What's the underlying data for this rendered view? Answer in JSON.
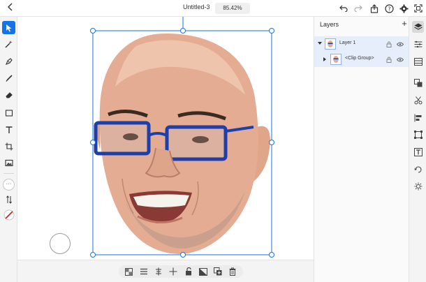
{
  "app": {
    "document_title": "Untitled-3",
    "zoom_level": "85.42%",
    "back_icon": "chevron-left-icon"
  },
  "topbar_icons": [
    "undo-icon",
    "redo-icon",
    "share-icon",
    "help-icon",
    "settings-icon",
    "fullscreen-icon"
  ],
  "left_tools": [
    "select-icon",
    "magic-select-icon",
    "pen-icon",
    "brush-icon",
    "eraser-icon",
    "rectangle-icon",
    "text-icon",
    "crop-icon",
    "image-icon",
    "more-icon",
    "swap-colors-icon",
    "color-swatch-icon"
  ],
  "more_label": "···",
  "bottom_tools": [
    "transparency-grid-icon",
    "align-icon",
    "distribute-icon",
    "move-icon",
    "unlock-icon",
    "mask-icon",
    "duplicate-icon",
    "delete-icon"
  ],
  "layers_panel": {
    "title": "Layers",
    "add_label": "+",
    "rows": [
      {
        "name": "Layer 1",
        "expanded": true
      },
      {
        "name": "<Clip Group>",
        "expanded": false
      }
    ]
  },
  "right_rail": [
    "layers-icon",
    "properties-icon",
    "libraries-icon",
    "pathfinder-icon",
    "scissors-icon",
    "align-panel-icon",
    "transform-icon",
    "type-icon",
    "repeat-icon",
    "effects-icon"
  ],
  "colors": {
    "accent": "#1473e6",
    "selection": "#1473e6",
    "layer_row_bg": "#e6eefb"
  }
}
